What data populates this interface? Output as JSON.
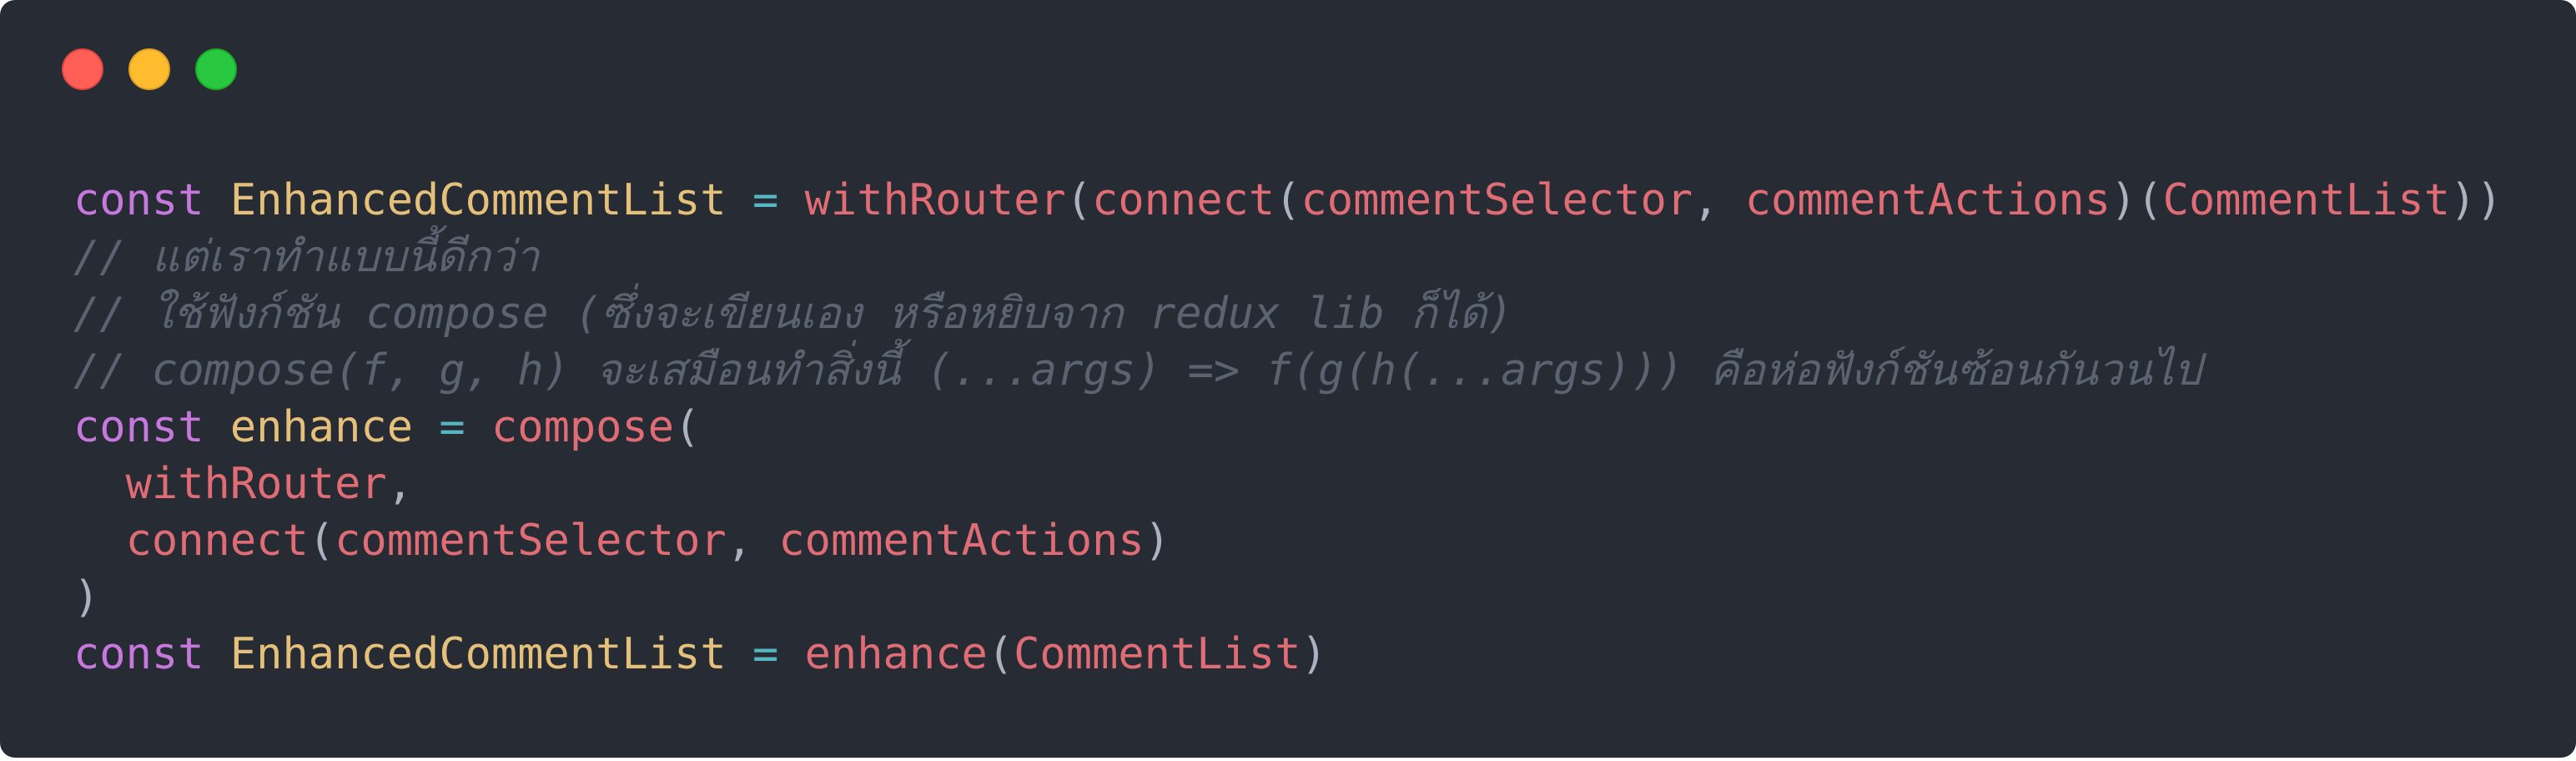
{
  "window": {
    "controls": [
      "close",
      "minimize",
      "maximize"
    ],
    "colors": {
      "background": "#272b34",
      "close": "#ff5f57",
      "minimize": "#febc2e",
      "maximize": "#28c840"
    }
  },
  "code": {
    "lines": [
      [
        {
          "t": "const",
          "c": "kw"
        },
        {
          "t": " ",
          "c": "punc"
        },
        {
          "t": "EnhancedCommentList",
          "c": "var"
        },
        {
          "t": " ",
          "c": "punc"
        },
        {
          "t": "=",
          "c": "op"
        },
        {
          "t": " ",
          "c": "punc"
        },
        {
          "t": "withRouter",
          "c": "fn"
        },
        {
          "t": "(",
          "c": "punc"
        },
        {
          "t": "connect",
          "c": "fn"
        },
        {
          "t": "(",
          "c": "punc"
        },
        {
          "t": "commentSelector",
          "c": "fn"
        },
        {
          "t": ", ",
          "c": "punc"
        },
        {
          "t": "commentActions",
          "c": "fn"
        },
        {
          "t": ")(",
          "c": "punc"
        },
        {
          "t": "CommentList",
          "c": "fn"
        },
        {
          "t": "))",
          "c": "punc"
        }
      ],
      [
        {
          "t": "// แต่เราทำแบบนี้ดีกว่า",
          "c": "cm"
        }
      ],
      [
        {
          "t": "// ใช้ฟังก์ชัน compose (ซึ่งจะเขียนเอง หรือหยิบจาก redux lib ก็ได้)",
          "c": "cm"
        }
      ],
      [
        {
          "t": "// compose(f, g, h) จะเสมือนทำสิ่งนี้ (...args) => f(g(h(...args))) คือห่อฟังก์ชันซ้อนกันวนไป",
          "c": "cm"
        }
      ],
      [
        {
          "t": "const",
          "c": "kw"
        },
        {
          "t": " ",
          "c": "punc"
        },
        {
          "t": "enhance",
          "c": "var"
        },
        {
          "t": " ",
          "c": "punc"
        },
        {
          "t": "=",
          "c": "op"
        },
        {
          "t": " ",
          "c": "punc"
        },
        {
          "t": "compose",
          "c": "fn"
        },
        {
          "t": "(",
          "c": "punc"
        }
      ],
      [
        {
          "t": "  ",
          "c": "punc"
        },
        {
          "t": "withRouter",
          "c": "fn"
        },
        {
          "t": ",",
          "c": "punc"
        }
      ],
      [
        {
          "t": "  ",
          "c": "punc"
        },
        {
          "t": "connect",
          "c": "fn"
        },
        {
          "t": "(",
          "c": "punc"
        },
        {
          "t": "commentSelector",
          "c": "fn"
        },
        {
          "t": ", ",
          "c": "punc"
        },
        {
          "t": "commentActions",
          "c": "fn"
        },
        {
          "t": ")",
          "c": "punc"
        }
      ],
      [
        {
          "t": ")",
          "c": "punc"
        }
      ],
      [
        {
          "t": "const",
          "c": "kw"
        },
        {
          "t": " ",
          "c": "punc"
        },
        {
          "t": "EnhancedCommentList",
          "c": "var"
        },
        {
          "t": " ",
          "c": "punc"
        },
        {
          "t": "=",
          "c": "op"
        },
        {
          "t": " ",
          "c": "punc"
        },
        {
          "t": "enhance",
          "c": "fn"
        },
        {
          "t": "(",
          "c": "punc"
        },
        {
          "t": "CommentList",
          "c": "fn"
        },
        {
          "t": ")",
          "c": "punc"
        }
      ]
    ],
    "syntax_colors": {
      "keyword": "#c678dd",
      "variable": "#e5c07b",
      "operator": "#56b6c2",
      "function": "#e06c75",
      "punctuation": "#abb2bf",
      "comment": "#5c6370"
    }
  }
}
